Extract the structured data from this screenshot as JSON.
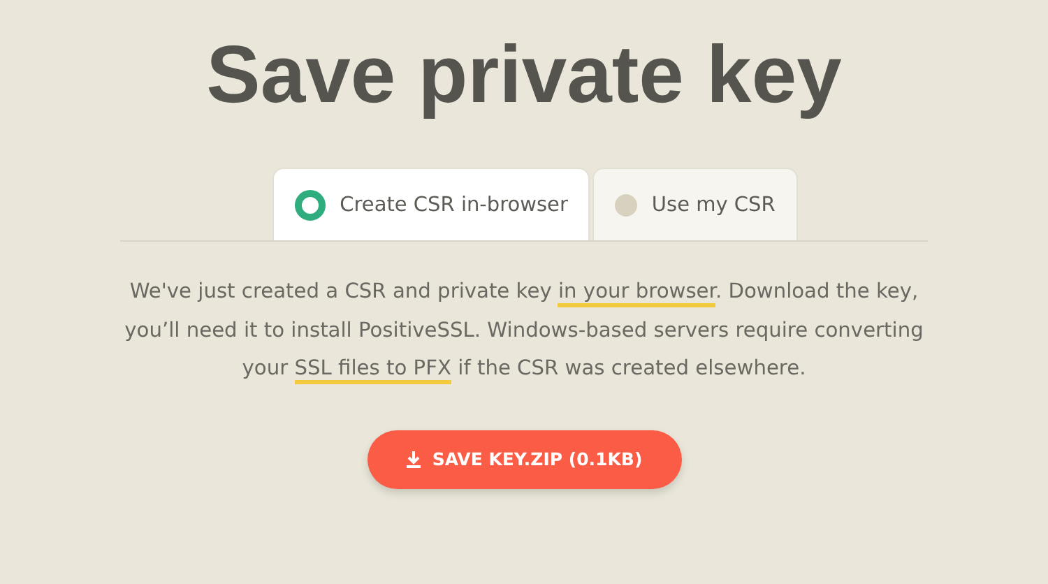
{
  "title": "Save private key",
  "tabs": [
    {
      "label": "Create CSR in-browser",
      "selected": true
    },
    {
      "label": "Use my CSR",
      "selected": false
    }
  ],
  "paragraph": [
    {
      "kind": "text",
      "text": "We've just created a CSR and private key "
    },
    {
      "kind": "link",
      "text": "in your browser"
    },
    {
      "kind": "text",
      "text": ". Download the key, you’ll need it to install PositiveSSL. Windows-based servers require converting your "
    },
    {
      "kind": "link",
      "text": "SSL files to PFX"
    },
    {
      "kind": "text",
      "text": " if the CSR was created elsewhere."
    }
  ],
  "button": {
    "label": "SAVE KEY.ZIP (0.1KB)"
  }
}
